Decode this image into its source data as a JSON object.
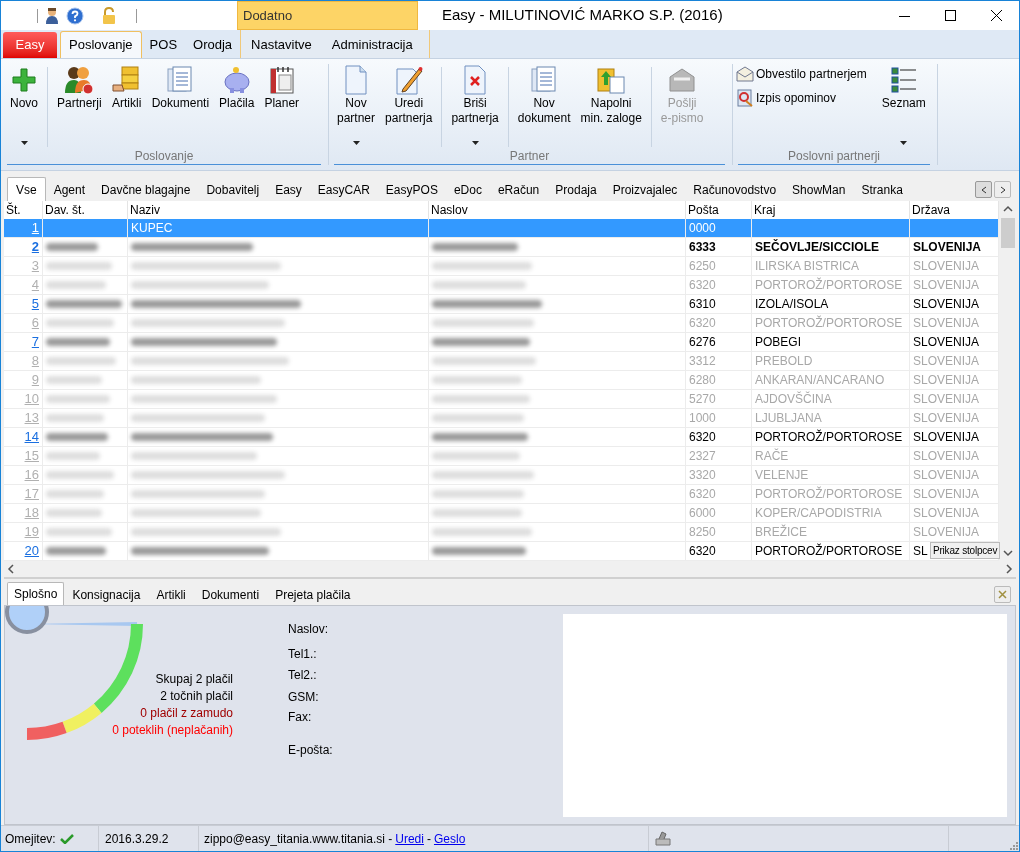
{
  "window": {
    "title": "Easy - MILUTINOVIĆ MARKO S.P. (2016)",
    "contextual_group": "Dodatno"
  },
  "ribbon_tabs": [
    {
      "label": "Easy",
      "kind": "app"
    },
    {
      "label": "Poslovanje",
      "kind": "normal",
      "selected": true
    },
    {
      "label": "POS",
      "kind": "normal",
      "selected": false
    },
    {
      "label": "Orodja",
      "kind": "normal",
      "selected": false
    },
    {
      "label": "Nastavitve",
      "kind": "contextual",
      "selected": false
    },
    {
      "label": "Administracija",
      "kind": "contextual",
      "selected": false
    }
  ],
  "ribbon_groups": [
    {
      "label": "Poslovanje",
      "items": [
        {
          "label": "Novo",
          "kind": "large",
          "menu": true,
          "separator_after": true
        },
        {
          "label": "Partnerji",
          "kind": "large"
        },
        {
          "label": "Artikli",
          "kind": "large"
        },
        {
          "label": "Dokumenti",
          "kind": "large"
        },
        {
          "label": "Plačila",
          "kind": "large"
        },
        {
          "label": "Planer",
          "kind": "large"
        }
      ]
    },
    {
      "label": "Partner",
      "items": [
        {
          "label": "Nov\npartner",
          "kind": "large",
          "menu": true
        },
        {
          "label": "Uredi\npartnerja",
          "kind": "large",
          "separator_after": true
        },
        {
          "label": "Briši\npartnerja",
          "kind": "large",
          "menu": true,
          "separator_after": true
        },
        {
          "label": "Nov\ndokument",
          "kind": "large"
        },
        {
          "label": "Napolni\nmin. zaloge",
          "kind": "large",
          "separator_after": true
        },
        {
          "label": "Pošlji\ne-pismo",
          "kind": "large",
          "disabled": true
        }
      ]
    },
    {
      "label": "Poslovni partnerji",
      "items": [
        {
          "label": "Obvestilo partnerjem",
          "kind": "small"
        },
        {
          "label": "Izpis opominov",
          "kind": "small"
        },
        {
          "label": "Seznam",
          "kind": "large",
          "menu": true
        }
      ]
    }
  ],
  "grid_tabs": [
    {
      "label": "Vse",
      "selected": true
    },
    {
      "label": "Agent",
      "selected": false
    },
    {
      "label": "Davčne blagajne",
      "selected": false
    },
    {
      "label": "Dobavitelj",
      "selected": false
    },
    {
      "label": "Easy",
      "selected": false
    },
    {
      "label": "EasyCAR",
      "selected": false
    },
    {
      "label": "EasyPOS",
      "selected": false
    },
    {
      "label": "eDoc",
      "selected": false
    },
    {
      "label": "eRačun",
      "selected": false
    },
    {
      "label": "Prodaja",
      "selected": false
    },
    {
      "label": "Proizvajalec",
      "selected": false
    },
    {
      "label": "Računovodstvo",
      "selected": false
    },
    {
      "label": "ShowMan",
      "selected": false
    },
    {
      "label": "Stranka",
      "selected": false
    }
  ],
  "table": {
    "columns": [
      "Št.",
      "Dav. št.",
      "Naziv",
      "Naslov",
      "Pošta",
      "Kraj",
      "Država"
    ],
    "rows": [
      {
        "st": "1",
        "naziv": "KUPEC",
        "posta": "0000",
        "selected": true,
        "active": true,
        "bold": false,
        "redacted": false
      },
      {
        "st": "2",
        "posta": "6333",
        "kraj": "SEČOVLJE/SICCIOLE",
        "drzava": "SLOVENIJA",
        "selected": false,
        "active": true,
        "bold": true,
        "redacted": true
      },
      {
        "st": "3",
        "posta": "6250",
        "kraj": "ILIRSKA BISTRICA",
        "drzava": "SLOVENIJA",
        "selected": false,
        "active": false,
        "bold": false,
        "redacted": true
      },
      {
        "st": "4",
        "posta": "6320",
        "kraj": "PORTOROŽ/PORTOROSE",
        "drzava": "SLOVENIJA",
        "selected": false,
        "active": false,
        "bold": false,
        "redacted": true
      },
      {
        "st": "5",
        "posta": "6310",
        "kraj": "IZOLA/ISOLA",
        "drzava": "SLOVENIJA",
        "selected": false,
        "active": true,
        "bold": false,
        "redacted": true
      },
      {
        "st": "6",
        "posta": "6320",
        "kraj": "PORTOROŽ/PORTOROSE",
        "drzava": "SLOVENIJA",
        "selected": false,
        "active": false,
        "bold": false,
        "redacted": true
      },
      {
        "st": "7",
        "posta": "6276",
        "kraj": "POBEGI",
        "drzava": "SLOVENIJA",
        "selected": false,
        "active": true,
        "bold": false,
        "redacted": true
      },
      {
        "st": "8",
        "posta": "3312",
        "kraj": "PREBOLD",
        "drzava": "SLOVENIJA",
        "selected": false,
        "active": false,
        "bold": false,
        "redacted": true
      },
      {
        "st": "9",
        "posta": "6280",
        "kraj": "ANKARAN/ANCARANO",
        "drzava": "SLOVENIJA",
        "selected": false,
        "active": false,
        "bold": false,
        "redacted": true
      },
      {
        "st": "10",
        "posta": "5270",
        "kraj": "AJDOVŠČINA",
        "drzava": "SLOVENIJA",
        "selected": false,
        "active": false,
        "bold": false,
        "redacted": true
      },
      {
        "st": "13",
        "posta": "1000",
        "kraj": "LJUBLJANA",
        "drzava": "SLOVENIJA",
        "selected": false,
        "active": false,
        "bold": false,
        "redacted": true
      },
      {
        "st": "14",
        "posta": "6320",
        "kraj": "PORTOROŽ/PORTOROSE",
        "drzava": "SLOVENIJA",
        "selected": false,
        "active": true,
        "bold": false,
        "redacted": true
      },
      {
        "st": "15",
        "posta": "2327",
        "kraj": "RAČE",
        "drzava": "SLOVENIJA",
        "selected": false,
        "active": false,
        "bold": false,
        "redacted": true
      },
      {
        "st": "16",
        "posta": "3320",
        "kraj": "VELENJE",
        "drzava": "SLOVENIJA",
        "selected": false,
        "active": false,
        "bold": false,
        "redacted": true
      },
      {
        "st": "17",
        "posta": "6320",
        "kraj": "PORTOROŽ/PORTOROSE",
        "drzava": "SLOVENIJA",
        "selected": false,
        "active": false,
        "bold": false,
        "redacted": true
      },
      {
        "st": "18",
        "posta": "6000",
        "kraj": "KOPER/CAPODISTRIA",
        "drzava": "SLOVENIJA",
        "selected": false,
        "active": false,
        "bold": false,
        "redacted": true
      },
      {
        "st": "19",
        "posta": "8250",
        "kraj": "BREŽICE",
        "drzava": "SLOVENIJA",
        "selected": false,
        "active": false,
        "bold": false,
        "redacted": true
      },
      {
        "st": "20",
        "posta": "6320",
        "kraj": "PORTOROŽ/PORTOROSE",
        "drzava": "SL",
        "selected": false,
        "active": true,
        "bold": false,
        "redacted": true
      }
    ],
    "tooltip": "Prikaz stolpcev"
  },
  "detail_tabs": [
    {
      "label": "Splošno",
      "selected": true
    },
    {
      "label": "Konsignacija",
      "selected": false
    },
    {
      "label": "Artikli",
      "selected": false
    },
    {
      "label": "Dokumenti",
      "selected": false
    },
    {
      "label": "Prejeta plačila",
      "selected": false
    }
  ],
  "payment_stats": [
    {
      "text": "Skupaj 2 plačil",
      "color": "#000000"
    },
    {
      "text": "2 točnih plačil",
      "color": "#000000"
    },
    {
      "text": "0 plačil z zamudo",
      "color": "#a00000"
    },
    {
      "text": "0 poteklih (neplačanih)",
      "color": "#ff0000"
    }
  ],
  "contact_labels": [
    "Naslov:",
    "Tel1.:",
    "Tel2.:",
    "GSM:",
    "Fax:",
    "E-pošta:"
  ],
  "status_bar": {
    "limit_label": "Omejitev:",
    "limit_ok": true,
    "version": "2016.3.29.2",
    "user": "zippo@easy_titania.www.titania.si -",
    "links": [
      "Uredi",
      "Geslo"
    ],
    "link_separator": "-"
  }
}
